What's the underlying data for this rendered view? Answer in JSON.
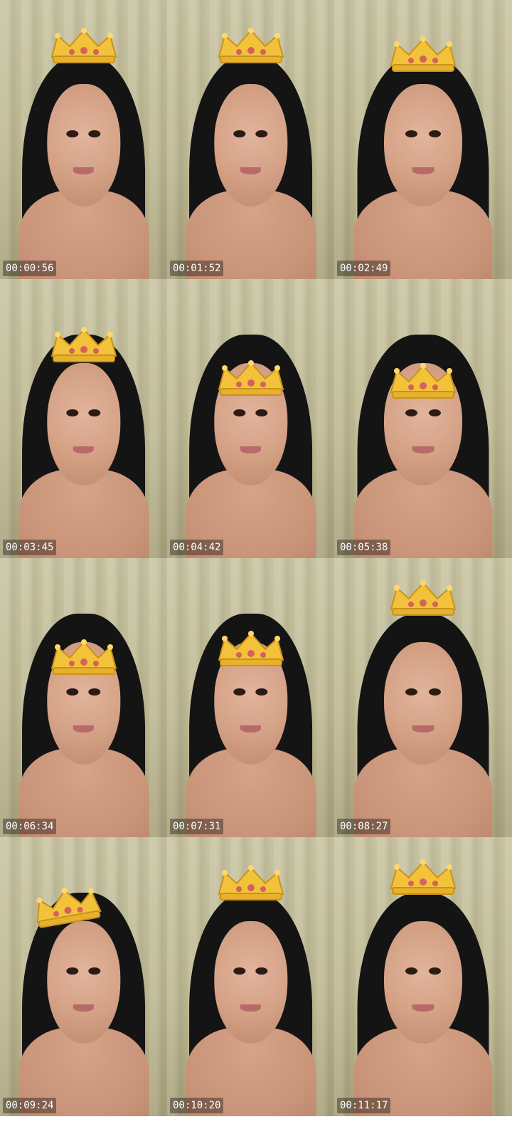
{
  "grid": {
    "columns": 3,
    "rows": 5,
    "timestamps": [
      "00:00:56",
      "00:01:52",
      "00:02:49",
      "00:03:45",
      "00:04:42",
      "00:05:38",
      "00:06:34",
      "00:07:31",
      "00:08:27",
      "00:09:24",
      "00:10:20",
      "00:11:17"
    ]
  },
  "icons": {
    "crown": "crown-icon"
  },
  "colors": {
    "curtain": "#c9c5a3",
    "crown_gold": "#f2c33a",
    "timestamp_text": "#ffffff"
  }
}
